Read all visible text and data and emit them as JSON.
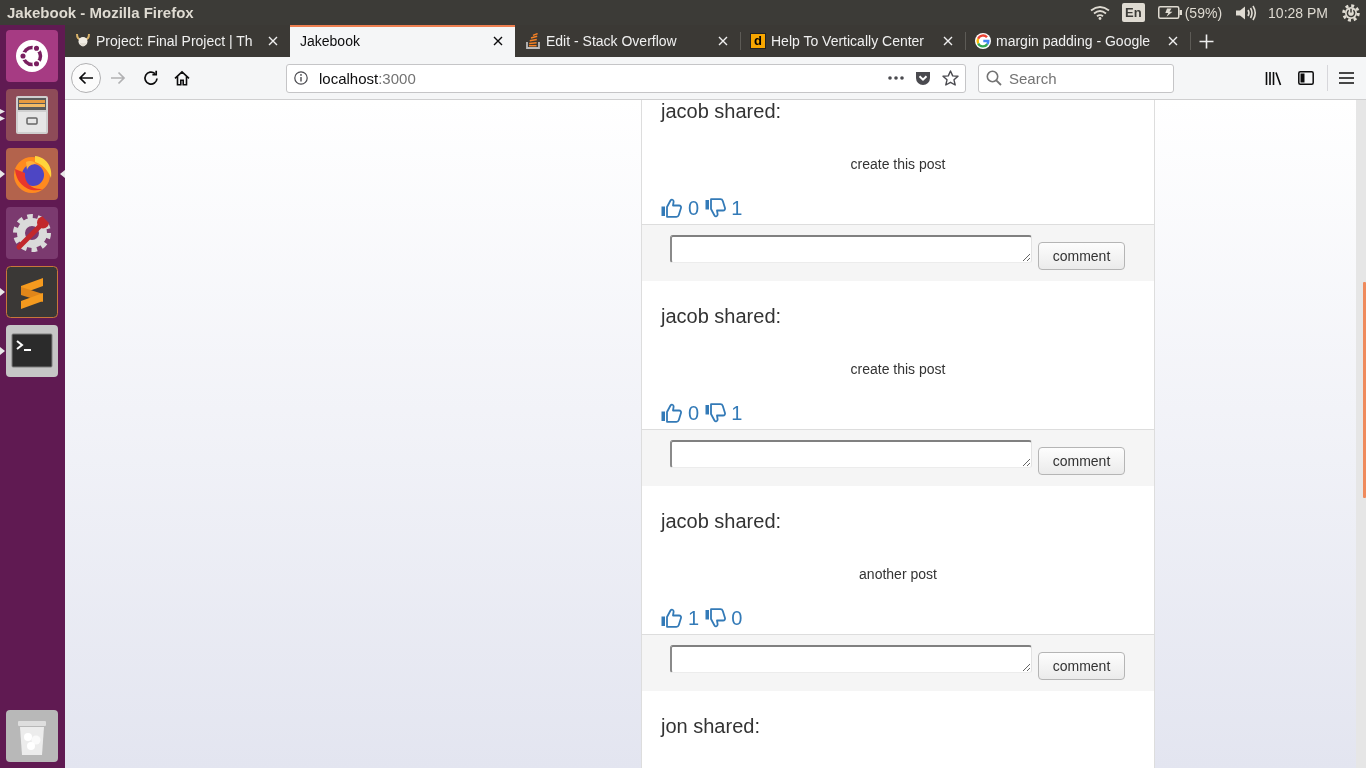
{
  "system_bar": {
    "window_title": "Jakebook - Mozilla Firefox",
    "keyboard_layout": "En",
    "battery": "(59%)",
    "clock": "10:28 PM"
  },
  "launcher": {
    "items": [
      {
        "kind": "dash",
        "running": false,
        "multiple_windows": false,
        "focused": false
      },
      {
        "kind": "files",
        "running": true,
        "multiple_windows": true,
        "focused": false
      },
      {
        "kind": "browser",
        "running": true,
        "multiple_windows": false,
        "focused": true
      },
      {
        "kind": "settings",
        "running": false,
        "multiple_windows": false,
        "focused": false
      },
      {
        "kind": "editor",
        "running": true,
        "multiple_windows": false,
        "focused": false
      },
      {
        "kind": "terminal",
        "running": true,
        "multiple_windows": false,
        "focused": false
      },
      {
        "kind": "trash",
        "running": false,
        "multiple_windows": false,
        "focused": false
      }
    ]
  },
  "tabs": [
    {
      "title": "Project: Final Project | Th",
      "selected": false,
      "icon": {
        "kind": "horned-head"
      }
    },
    {
      "title": "Jakebook",
      "selected": true
    },
    {
      "title": "Edit - Stack Overflow",
      "selected": false,
      "icon": {
        "kind": "stack"
      }
    },
    {
      "title": "Help To Vertically Center",
      "selected": false,
      "icon": {
        "kind": "letter",
        "text": "d"
      }
    },
    {
      "title": "margin padding - Google",
      "selected": false,
      "icon": {
        "kind": "g"
      }
    }
  ],
  "nav_buttons": [
    {
      "kind": "back",
      "disabled": false
    },
    {
      "kind": "forward",
      "disabled": true
    },
    {
      "kind": "reload",
      "disabled": false
    },
    {
      "kind": "home",
      "disabled": false
    }
  ],
  "address_bar": {
    "host": "localhost",
    "port": ":3000"
  },
  "search": {
    "placeholder": "Search"
  },
  "posts": [
    {
      "heading": "jacob shared:",
      "body": "create this post",
      "likes": "0",
      "dislikes": "1",
      "comment_button": "comment"
    },
    {
      "heading": "jacob shared:",
      "body": "create this post",
      "likes": "0",
      "dislikes": "1",
      "comment_button": "comment"
    },
    {
      "heading": "jacob shared:",
      "body": "another post",
      "likes": "1",
      "dislikes": "0",
      "comment_button": "comment"
    },
    {
      "heading": "jon shared:"
    }
  ]
}
